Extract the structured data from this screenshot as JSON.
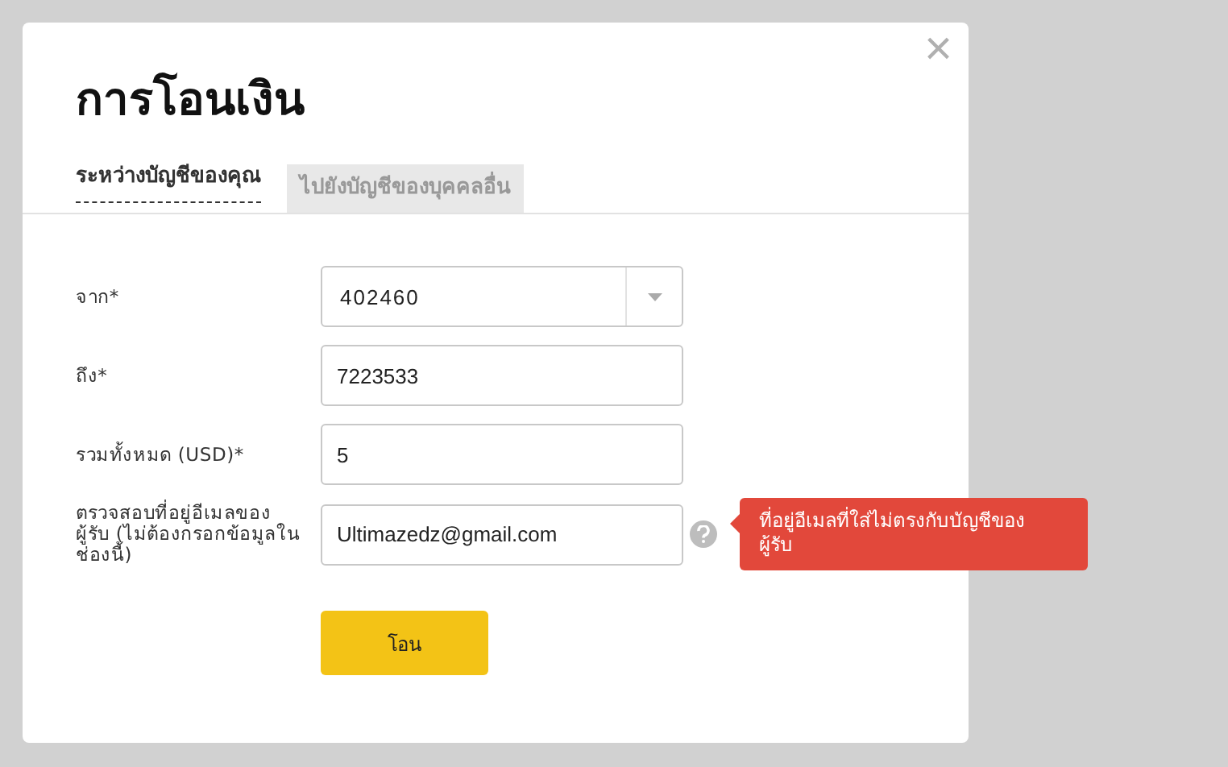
{
  "dialog": {
    "title": "การโอนเงิน",
    "close": "×"
  },
  "tabs": [
    {
      "label": "ระหว่างบัญชีของคุณ",
      "selected": true
    },
    {
      "label": "ไปยังบัญชีของบุคคลอื่น",
      "selected": false
    }
  ],
  "fields": [
    {
      "kind": "select",
      "label": "จาก*",
      "value": "402460"
    },
    {
      "kind": "text",
      "label": "ถึง*",
      "value": "7223533"
    },
    {
      "kind": "text",
      "label": "รวมทั้งหมด (USD)*",
      "value": "5"
    },
    {
      "kind": "help",
      "label": "ตรวจสอบที่อยู่อีเมลของผู้รับ (ไม่ต้องกรอกข้อมูลในช่องนี้)",
      "value": "Ultimazedz@gmail.com",
      "error": "ที่อยู่อีเมลที่ใส่ไม่ตรงกับบัญชีของผู้รับ"
    }
  ],
  "submit": "โอน"
}
